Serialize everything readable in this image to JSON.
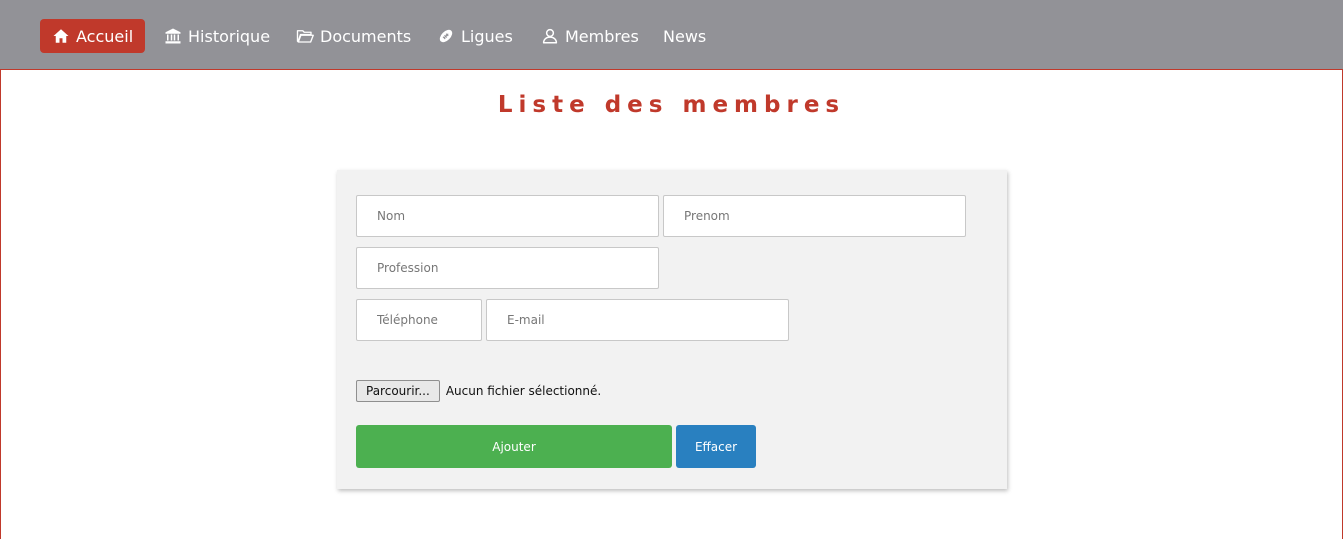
{
  "nav": {
    "items": [
      {
        "label": "Accueil",
        "icon": "home-icon",
        "active": true
      },
      {
        "label": "Historique",
        "icon": "institution-icon",
        "active": false
      },
      {
        "label": "Documents",
        "icon": "folder-open-icon",
        "active": false
      },
      {
        "label": "Ligues",
        "icon": "football-icon",
        "active": false
      },
      {
        "label": "Membres",
        "icon": "user-icon",
        "active": false
      },
      {
        "label": "News",
        "icon": "",
        "active": false
      }
    ],
    "colors": {
      "bar": "#929297",
      "active": "#c0392b",
      "text": "#ffffff"
    }
  },
  "page": {
    "title": "Liste des membres",
    "accent_color": "#c0392b"
  },
  "form": {
    "nom": {
      "placeholder": "Nom",
      "value": ""
    },
    "prenom": {
      "placeholder": "Prenom",
      "value": ""
    },
    "profession": {
      "placeholder": "Profession",
      "value": ""
    },
    "telephone": {
      "placeholder": "Téléphone",
      "value": ""
    },
    "email": {
      "placeholder": "E-mail",
      "value": ""
    },
    "file": {
      "button_label": "Parcourir...",
      "status": "Aucun fichier sélectionné."
    },
    "submit_label": "Ajouter",
    "reset_label": "Effacer",
    "colors": {
      "submit": "#4cb050",
      "reset": "#2980c0",
      "card": "#f2f2f2"
    }
  }
}
